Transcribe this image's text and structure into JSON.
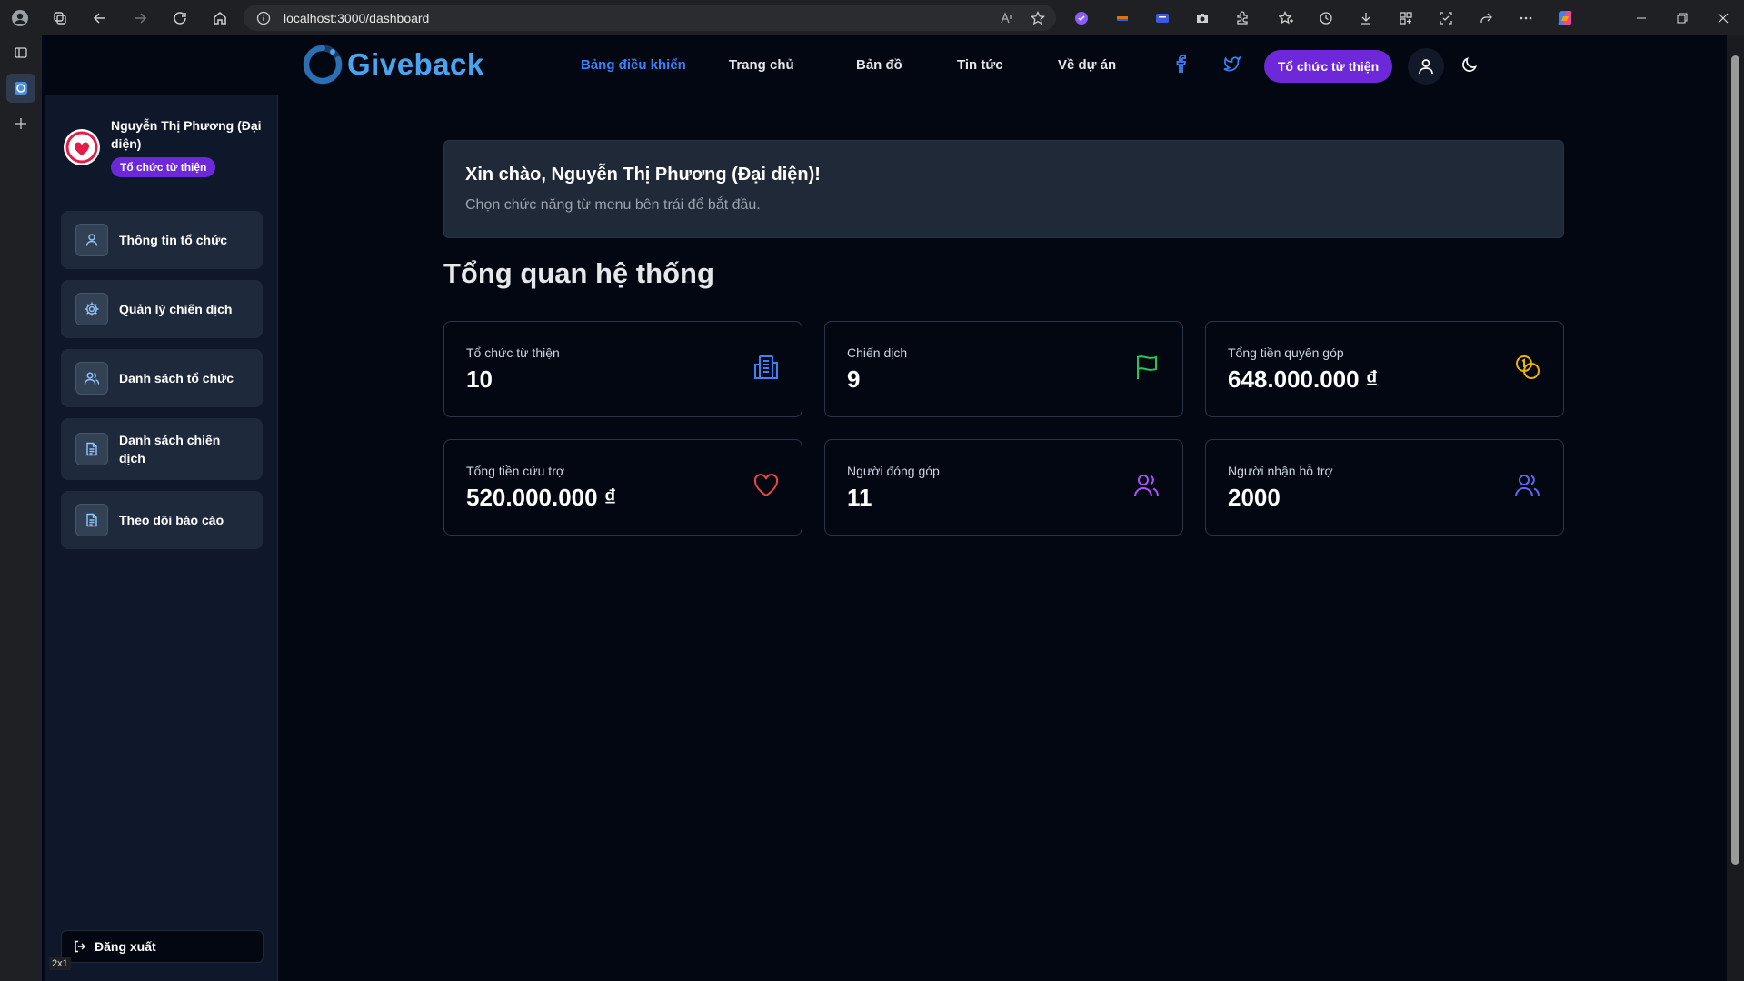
{
  "browser": {
    "url": "localhost:3000/dashboard",
    "zoom_badge": "2x1"
  },
  "site": {
    "logo_text": "Giveback"
  },
  "nav": {
    "links": [
      "Bảng điều khiển",
      "Trang chủ",
      "Bản đồ",
      "Tin tức",
      "Về dự án"
    ],
    "active_index": 0,
    "org_button": "Tổ chức từ thiện"
  },
  "profile": {
    "name": "Nguyễn Thị Phương (Đại diện)",
    "badge": "Tổ chức từ thiện"
  },
  "sidebar": {
    "items": [
      {
        "label": "Thông tin tổ chức",
        "icon": "user-icon"
      },
      {
        "label": "Quản lý chiến dịch",
        "icon": "gear-icon"
      },
      {
        "label": "Danh sách tổ chức",
        "icon": "users-icon"
      },
      {
        "label": "Danh sách chiến dịch",
        "icon": "document-icon"
      },
      {
        "label": "Theo dõi báo cáo",
        "icon": "document-icon"
      }
    ],
    "logout": "Đăng xuất"
  },
  "welcome": {
    "title": "Xin chào, Nguyễn Thị Phương (Đại diện)!",
    "subtitle": "Chọn chức năng từ menu bên trái để bắt đầu."
  },
  "overview": {
    "title": "Tổng quan hệ thống",
    "cards": [
      {
        "label": "Tổ chức từ thiện",
        "value": "10",
        "icon": "building-icon",
        "color": "#3b82f6"
      },
      {
        "label": "Chiến dịch",
        "value": "9",
        "icon": "flag-icon",
        "color": "#22c55e"
      },
      {
        "label": "Tổng tiền quyên góp",
        "value": "648.000.000 ₫",
        "icon": "coins-icon",
        "color": "#eab308"
      },
      {
        "label": "Tổng tiền cứu trợ",
        "value": "520.000.000 ₫",
        "icon": "heart-icon",
        "color": "#ef4444"
      },
      {
        "label": "Người đóng góp",
        "value": "11",
        "icon": "users-icon",
        "color": "#a855f7"
      },
      {
        "label": "Người nhận hỗ trợ",
        "value": "2000",
        "icon": "users-icon",
        "color": "#6366f1"
      }
    ]
  }
}
